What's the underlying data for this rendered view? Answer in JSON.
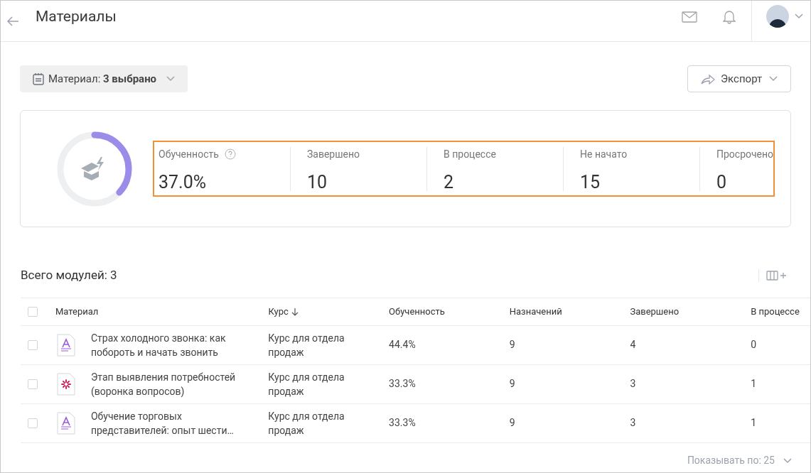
{
  "header": {
    "title": "Материалы"
  },
  "filter": {
    "label": "Материал:",
    "value": "3 выбрано"
  },
  "export_button": {
    "label": "Экспорт"
  },
  "summary": {
    "level": 0.37,
    "highlighted": true,
    "stats": [
      {
        "label": "Обученность",
        "value": "37.0%",
        "help": true
      },
      {
        "label": "Завершено",
        "value": "10",
        "help": false
      },
      {
        "label": "В процессе",
        "value": "2",
        "help": false
      },
      {
        "label": "Не начато",
        "value": "15",
        "help": false
      },
      {
        "label": "Просрочено",
        "value": "0",
        "help": false
      }
    ]
  },
  "table": {
    "title": "Всего модулей: 3",
    "all_checked": false,
    "columns": [
      {
        "label": "Материал",
        "sorted": false
      },
      {
        "label": "Курс",
        "sorted": true
      },
      {
        "label": "Обученность",
        "sorted": false
      },
      {
        "label": "Назначений",
        "sorted": false
      },
      {
        "label": "Завершено",
        "sorted": false
      },
      {
        "label": "В процессе",
        "sorted": false
      }
    ],
    "rows": [
      {
        "checked": false,
        "kind": "text",
        "material": "Страх холодного звонка: как побороть и начать звонить",
        "course": "Курс для отдела продаж",
        "progress": "44.4%",
        "assigned": "9",
        "completed": "4",
        "in_progress": "0"
      },
      {
        "checked": false,
        "kind": "spark",
        "material": "Этап выявления потребностей (воронка вопросов)",
        "course": "Курс для отдела продаж",
        "progress": "33.3%",
        "assigned": "9",
        "completed": "3",
        "in_progress": "1"
      },
      {
        "checked": false,
        "kind": "text",
        "material": "Обучение торговых представителей: опыт шести…",
        "course": "Курс для отдела продаж",
        "progress": "33.3%",
        "assigned": "9",
        "completed": "3",
        "in_progress": "1"
      }
    ]
  },
  "pagination": {
    "label": "Показывать по: 25"
  }
}
